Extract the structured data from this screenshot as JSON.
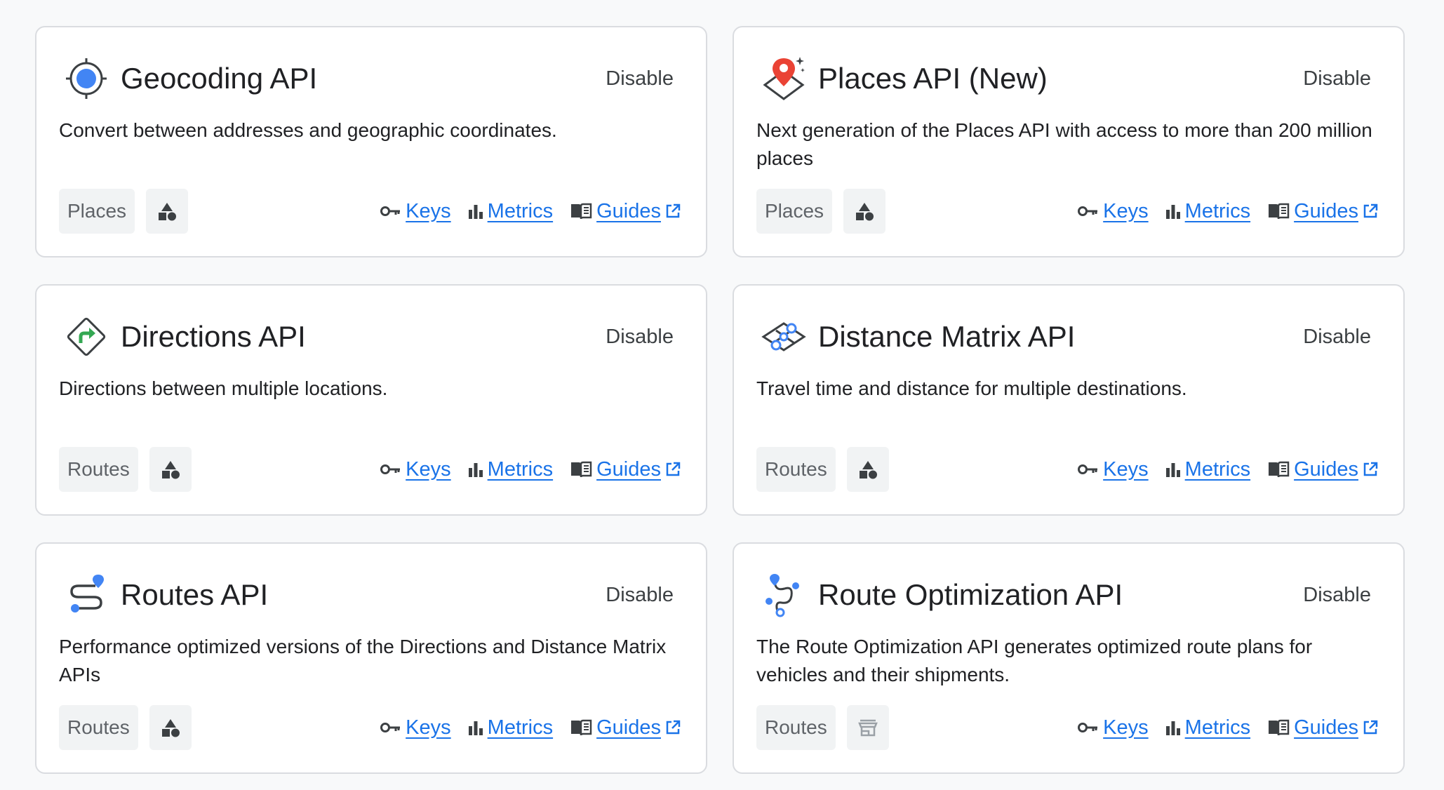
{
  "cards": [
    {
      "title": "Geocoding API",
      "icon": "geocoding-icon",
      "disable_label": "Disable",
      "description": "Convert between addresses and geographic coordinates.",
      "category": "Places",
      "category_icon": "shapes-icon",
      "links": {
        "keys": "Keys",
        "metrics": "Metrics",
        "guides": "Guides"
      }
    },
    {
      "title": "Places API (New)",
      "icon": "places-new-icon",
      "disable_label": "Disable",
      "description": "Next generation of the Places API with access to more than 200 million places",
      "category": "Places",
      "category_icon": "shapes-icon",
      "links": {
        "keys": "Keys",
        "metrics": "Metrics",
        "guides": "Guides"
      }
    },
    {
      "title": "Directions API",
      "icon": "directions-icon",
      "disable_label": "Disable",
      "description": "Directions between multiple locations.",
      "category": "Routes",
      "category_icon": "shapes-icon",
      "links": {
        "keys": "Keys",
        "metrics": "Metrics",
        "guides": "Guides"
      }
    },
    {
      "title": "Distance Matrix API",
      "icon": "distance-matrix-icon",
      "disable_label": "Disable",
      "description": "Travel time and distance for multiple destinations.",
      "category": "Routes",
      "category_icon": "shapes-icon",
      "links": {
        "keys": "Keys",
        "metrics": "Metrics",
        "guides": "Guides"
      }
    },
    {
      "title": "Routes API",
      "icon": "routes-icon",
      "disable_label": "Disable",
      "description": "Performance optimized versions of the Directions and Distance Matrix APIs",
      "category": "Routes",
      "category_icon": "shapes-icon",
      "links": {
        "keys": "Keys",
        "metrics": "Metrics",
        "guides": "Guides"
      }
    },
    {
      "title": "Route Optimization API",
      "icon": "route-optimization-icon",
      "disable_label": "Disable",
      "description": "The Route Optimization API generates optimized route plans for vehicles and their shipments.",
      "category": "Routes",
      "category_icon": "storefront-icon",
      "links": {
        "keys": "Keys",
        "metrics": "Metrics",
        "guides": "Guides"
      }
    }
  ],
  "colors": {
    "link": "#1a73e8",
    "border": "#dadce0",
    "chip_bg": "#f1f3f4"
  }
}
